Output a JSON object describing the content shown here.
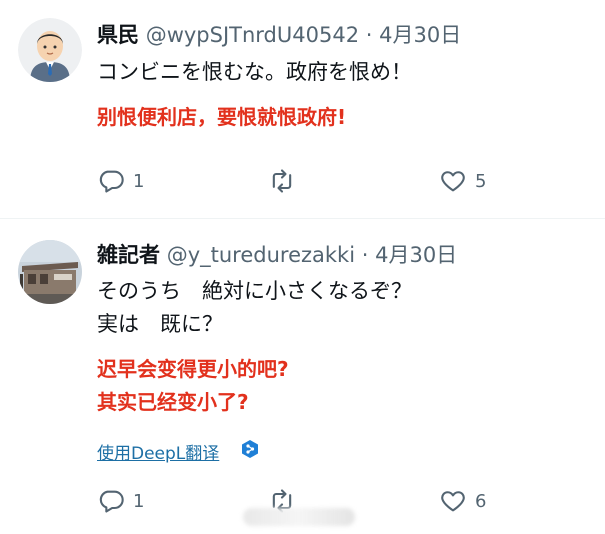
{
  "tweets": [
    {
      "name": "県民",
      "handle": "@wypSJTnrdU40542",
      "separator": "·",
      "date": "4月30日",
      "text": "コンビニを恨むな。政府を恨め！",
      "translation": [
        "别恨便利店，要恨就恨政府!"
      ],
      "actions": {
        "reply": "1",
        "retweet": "",
        "like": "5"
      },
      "avatar_icon": "man-avatar-icon"
    },
    {
      "name": "雑記者",
      "handle": "@y_turedurezakki",
      "separator": "·",
      "date": "4月30日",
      "text_lines": [
        "そのうち　絶対に小さくなるぞ？",
        "実は　既に？"
      ],
      "translation": [
        "迟早会变得更小的吧?",
        "其实已经变小了?"
      ],
      "deepl_link": "使用DeepL翻译",
      "actions": {
        "reply": "1",
        "retweet": "",
        "like": "6"
      },
      "avatar_icon": "building-photo-avatar"
    }
  ],
  "colors": {
    "translation": "#e2311d",
    "secondary_text": "#536471",
    "link": "#1d6fa5",
    "deepl_badge": "#1f7fd6"
  }
}
